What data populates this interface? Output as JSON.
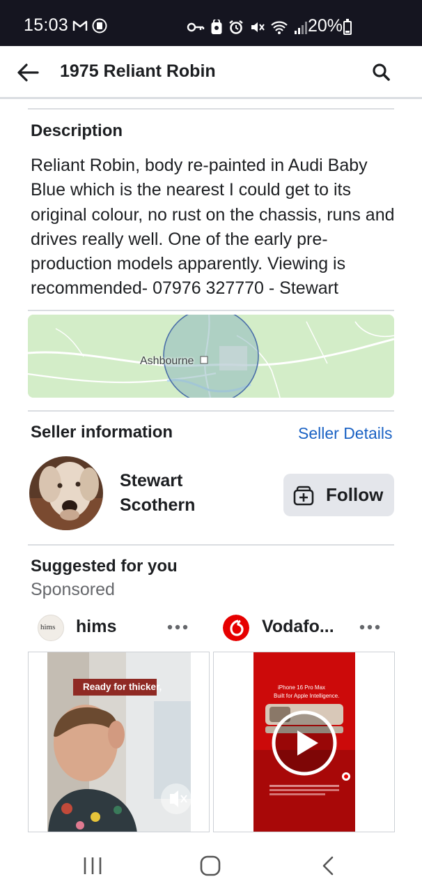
{
  "status_bar": {
    "time": "15:03",
    "battery_text": "20%",
    "battery_level": 0.2,
    "icons": [
      "gmail-icon",
      "clipboard-icon",
      "key-icon",
      "lock-icon",
      "alarm-icon",
      "mute-icon",
      "wifi-icon",
      "signal-icon",
      "battery-icon"
    ]
  },
  "header": {
    "title": "1975 Reliant Robin"
  },
  "description": {
    "heading": "Description",
    "text": "Reliant Robin, body re-painted in Audi Baby Blue which is the nearest I could get to its original colour, no rust on the chassis, runs and drives really well. One of the early pre-production models apparently. Viewing is recommended- 07976 327770 - Stewart"
  },
  "map": {
    "location_label": "Ashbourne"
  },
  "seller": {
    "heading": "Seller information",
    "details_link": "Seller Details",
    "name": "Stewart Scothern",
    "follow_label": "Follow"
  },
  "suggested": {
    "heading": "Suggested for you",
    "sponsored_label": "Sponsored",
    "ads": [
      {
        "advertiser": "hims",
        "logo_text": "hims",
        "caption": "Ready for thicker,"
      },
      {
        "advertiser": "Vodafo...",
        "headline": "iPhone 16 Pro Max",
        "subline": "Built for Apple Intelligence."
      }
    ]
  },
  "colors": {
    "accent_link": "#1a62c4",
    "status_bar_bg": "#151520",
    "button_bg": "#e4e6eb",
    "vodafone_red": "#e60000"
  }
}
